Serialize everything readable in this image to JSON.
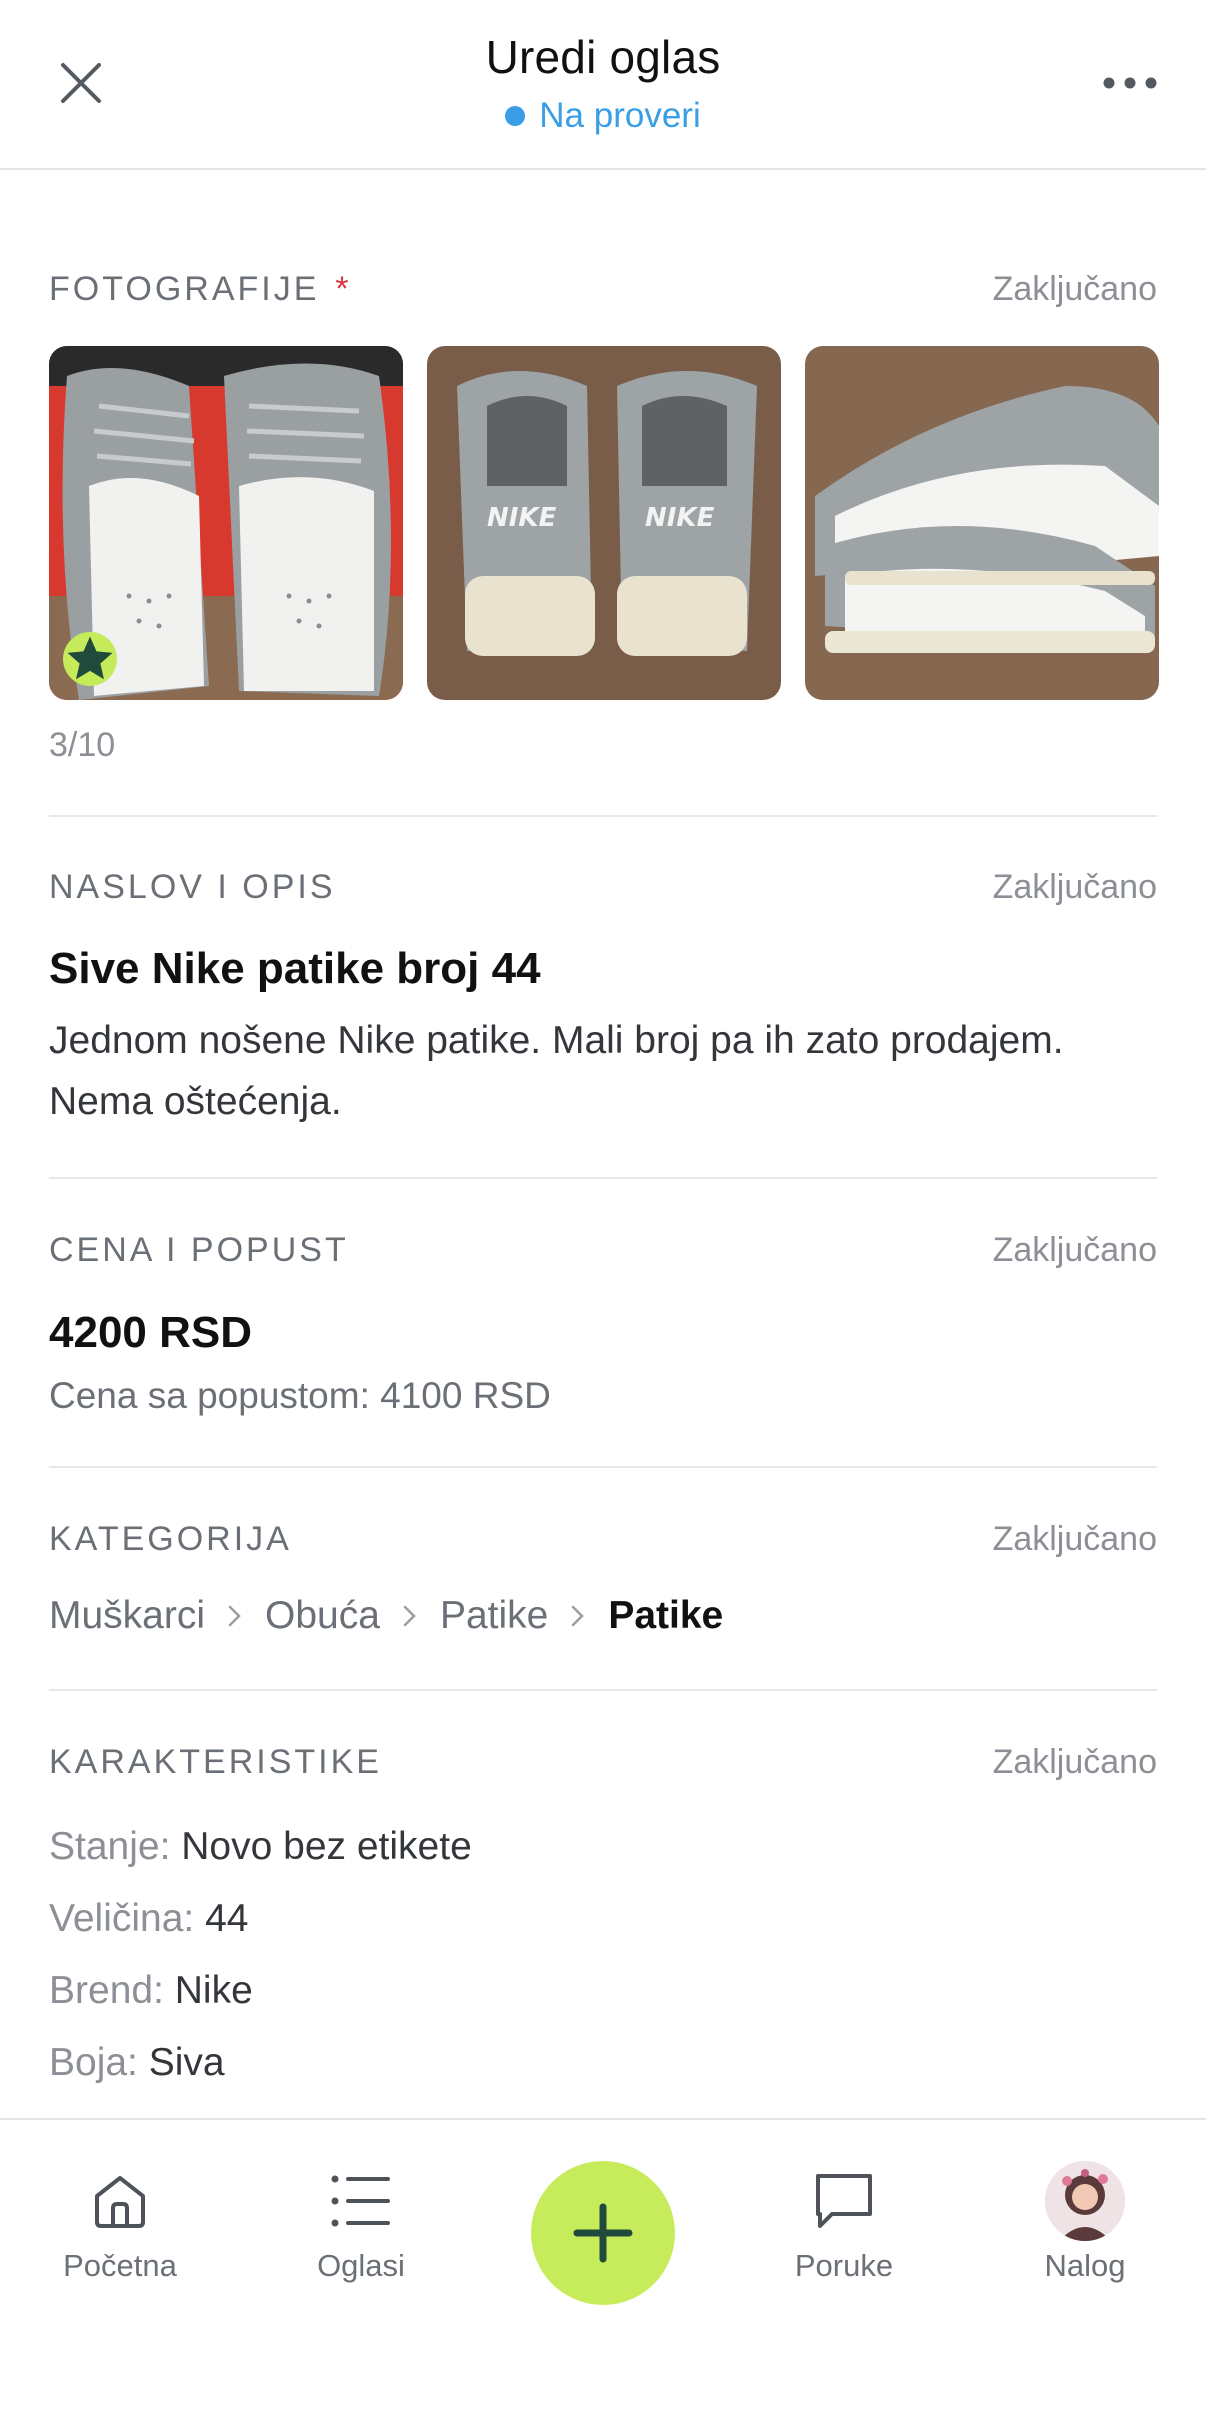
{
  "header": {
    "title": "Uredi oglas",
    "status": "Na proveri"
  },
  "locked_label": "Zaključano",
  "photos": {
    "label": "FOTOGRAFIJE",
    "required_mark": "*",
    "count": "3/10",
    "images": [
      "sneakers-top-view",
      "sneakers-back-view",
      "sneakers-side-view"
    ]
  },
  "title_desc": {
    "label": "NASLOV I OPIS",
    "title": "Sive Nike patike broj 44",
    "description": "Jednom nošene Nike patike. Mali broj pa ih zato prodajem. Nema oštećenja."
  },
  "price": {
    "label": "CENA I POPUST",
    "value": "4200 RSD",
    "discount": "Cena sa popustom: 4100 RSD"
  },
  "category": {
    "label": "KATEGORIJA",
    "path": [
      "Muškarci",
      "Obuća",
      "Patike",
      "Patike"
    ]
  },
  "attributes": {
    "label": "KARAKTERISTIKE",
    "items": [
      {
        "key": "Stanje:",
        "value": "Novo bez etikete"
      },
      {
        "key": "Veličina:",
        "value": "44"
      },
      {
        "key": "Brend:",
        "value": "Nike"
      },
      {
        "key": "Boja:",
        "value": "Siva"
      }
    ]
  },
  "tabbar": {
    "items": [
      {
        "label": "Početna",
        "icon": "home-icon"
      },
      {
        "label": "Oglasi",
        "icon": "list-icon"
      },
      {
        "label": "Poruke",
        "icon": "chat-icon"
      },
      {
        "label": "Nalog",
        "icon": "avatar"
      }
    ],
    "fab_icon": "plus-icon"
  },
  "colors": {
    "accent": "#c7ec5b",
    "status": "#3a9ee6",
    "required": "#d8383e"
  }
}
